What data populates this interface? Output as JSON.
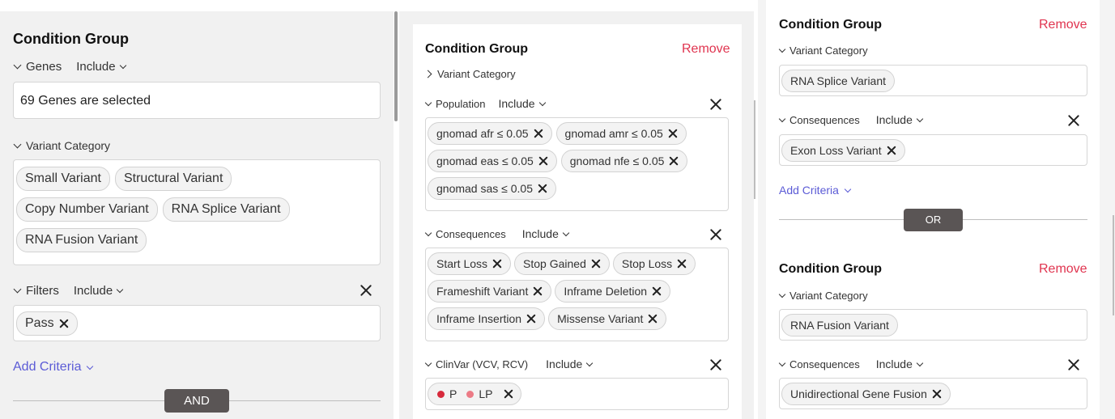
{
  "colors": {
    "remove": "#e0344f",
    "link": "#5b5bd6",
    "dot_p": "#d72a3c",
    "dot_lp": "#ec7b86",
    "op_button": "#5a5555"
  },
  "left": {
    "title": "Condition Group",
    "genes": {
      "label": "Genes",
      "mode": "Include",
      "value": "69 Genes are selected"
    },
    "variant_category": {
      "label": "Variant Category",
      "chips": [
        "Small Variant",
        "Structural Variant",
        "Copy Number Variant",
        "RNA Splice Variant",
        "RNA Fusion Variant"
      ]
    },
    "filters": {
      "label": "Filters",
      "mode": "Include",
      "chips": [
        "Pass"
      ]
    },
    "add_criteria": "Add Criteria",
    "operator": "AND"
  },
  "middle": {
    "title": "Condition Group",
    "remove": "Remove",
    "variant_category": {
      "label": "Variant Category"
    },
    "population": {
      "label": "Population",
      "mode": "Include",
      "chips": [
        "gnomad afr ≤ 0.05",
        "gnomad amr ≤ 0.05",
        "gnomad eas ≤ 0.05",
        "gnomad nfe ≤ 0.05",
        "gnomad sas ≤ 0.05"
      ]
    },
    "consequences": {
      "label": "Consequences",
      "mode": "Include",
      "chips": [
        "Start Loss",
        "Stop Gained",
        "Stop Loss",
        "Frameshift Variant",
        "Inframe Deletion",
        "Inframe Insertion",
        "Missense Variant"
      ]
    },
    "clinvar": {
      "label": "ClinVar (VCV, RCV)",
      "mode": "Include",
      "items": [
        "P",
        "LP"
      ]
    }
  },
  "right": {
    "group1": {
      "title": "Condition Group",
      "remove": "Remove",
      "variant_category": {
        "label": "Variant Category",
        "chips": [
          "RNA Splice Variant"
        ]
      },
      "consequences": {
        "label": "Consequences",
        "mode": "Include",
        "chips": [
          "Exon Loss Variant"
        ]
      },
      "add_criteria": "Add Criteria"
    },
    "operator": "OR",
    "group2": {
      "title": "Condition Group",
      "remove": "Remove",
      "variant_category": {
        "label": "Variant Category",
        "chips": [
          "RNA Fusion Variant"
        ]
      },
      "consequences": {
        "label": "Consequences",
        "mode": "Include",
        "chips": [
          "Unidirectional Gene Fusion"
        ]
      }
    }
  }
}
